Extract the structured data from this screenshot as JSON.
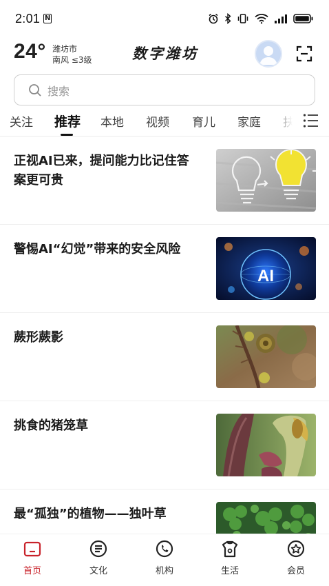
{
  "status_bar": {
    "time": "2:01",
    "nfc_badge": "N"
  },
  "header": {
    "temperature": "24°",
    "city": "潍坊市",
    "wind": "南风  ≤3级",
    "logo": "数字潍坊"
  },
  "search": {
    "placeholder": "搜索"
  },
  "tabs": [
    {
      "label": "关注"
    },
    {
      "label": "推荐",
      "active": true
    },
    {
      "label": "本地"
    },
    {
      "label": "视频"
    },
    {
      "label": "育儿"
    },
    {
      "label": "家庭"
    },
    {
      "label": "扶"
    }
  ],
  "news": [
    {
      "title": "正视AI已来，提问能力比记住答案更可贵",
      "thumb": "lightbulb"
    },
    {
      "title": "警惕AI“幻觉”带来的安全风险",
      "thumb": "ai-sphere",
      "thumb_text": "AI"
    },
    {
      "title": "蕨形蕨影",
      "thumb": "fern"
    },
    {
      "title": "挑食的猪笼草",
      "thumb": "pitcher-plant"
    },
    {
      "title": "最“孤独”的植物——独叶草",
      "thumb": "clover"
    }
  ],
  "bottom_nav": [
    {
      "label": "首页",
      "icon": "home-icon",
      "active": true
    },
    {
      "label": "文化",
      "icon": "culture-icon"
    },
    {
      "label": "机构",
      "icon": "phone-icon"
    },
    {
      "label": "生活",
      "icon": "life-icon"
    },
    {
      "label": "会员",
      "icon": "member-icon"
    }
  ],
  "colors": {
    "accent": "#c8222a",
    "text": "#1a1a1a"
  }
}
